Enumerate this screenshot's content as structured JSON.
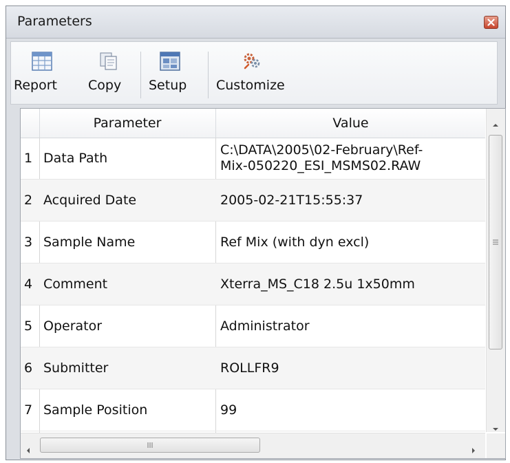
{
  "window": {
    "title": "Parameters"
  },
  "toolbar": {
    "buttons": [
      {
        "label": "Report",
        "icon": "report-grid-icon"
      },
      {
        "label": "Copy",
        "icon": "copy-icon"
      },
      {
        "label": "Setup",
        "icon": "setup-icon"
      },
      {
        "label": "Customize",
        "icon": "customize-icon"
      }
    ]
  },
  "table": {
    "columns": [
      "Parameter",
      "Value"
    ],
    "rows": [
      {
        "num": "1",
        "param": "Data Path",
        "value": "C:\\DATA\\2005\\02-February\\Ref-\nMix-050220_ESI_MSMS02.RAW"
      },
      {
        "num": "2",
        "param": "Acquired Date",
        "value": "2005-02-21T15:55:37"
      },
      {
        "num": "3",
        "param": "Sample Name",
        "value": "Ref Mix (with dyn excl)"
      },
      {
        "num": "4",
        "param": "Comment",
        "value": "Xterra_MS_C18 2.5u 1x50mm"
      },
      {
        "num": "5",
        "param": "Operator",
        "value": "Administrator"
      },
      {
        "num": "6",
        "param": "Submitter",
        "value": "ROLLFR9"
      },
      {
        "num": "7",
        "param": "Sample Position",
        "value": "99"
      }
    ]
  },
  "colors": {
    "titlebar": "#dfe3e9",
    "close": "#c6452d",
    "alt_row": "#f5f5f5"
  }
}
